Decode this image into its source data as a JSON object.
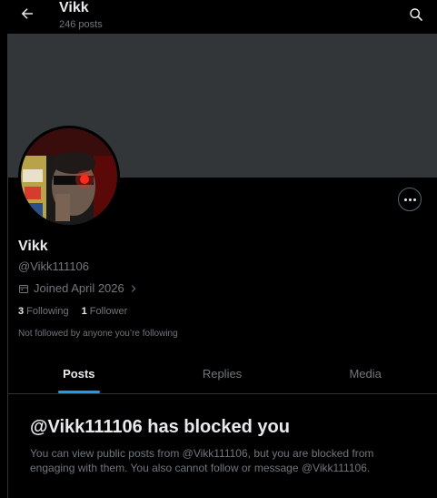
{
  "header": {
    "title": "Vikk",
    "post_count": "246 posts",
    "back_icon": "arrow-left-icon",
    "search_icon": "search-icon"
  },
  "profile": {
    "name": "Vikk",
    "handle": "@Vikk111106",
    "joined": "Joined April 2026",
    "following_count": "3",
    "following_label": "Following",
    "followers_count": "1",
    "followers_label": "Follower",
    "followed_status": "Not followed by anyone you’re following"
  },
  "tabs": [
    {
      "label": "Posts",
      "active": true
    },
    {
      "label": "Replies",
      "active": false
    },
    {
      "label": "Media",
      "active": false
    }
  ],
  "blocked": {
    "title": "@Vikk111106 has blocked you",
    "message": "You can view public posts from @Vikk111106, but you are blocked from engaging with them. You also cannot follow or message @Vikk111106."
  },
  "colors": {
    "background": "#000000",
    "banner": "#333639",
    "accent": "#1d9bf0",
    "muted_text": "#71767b"
  }
}
